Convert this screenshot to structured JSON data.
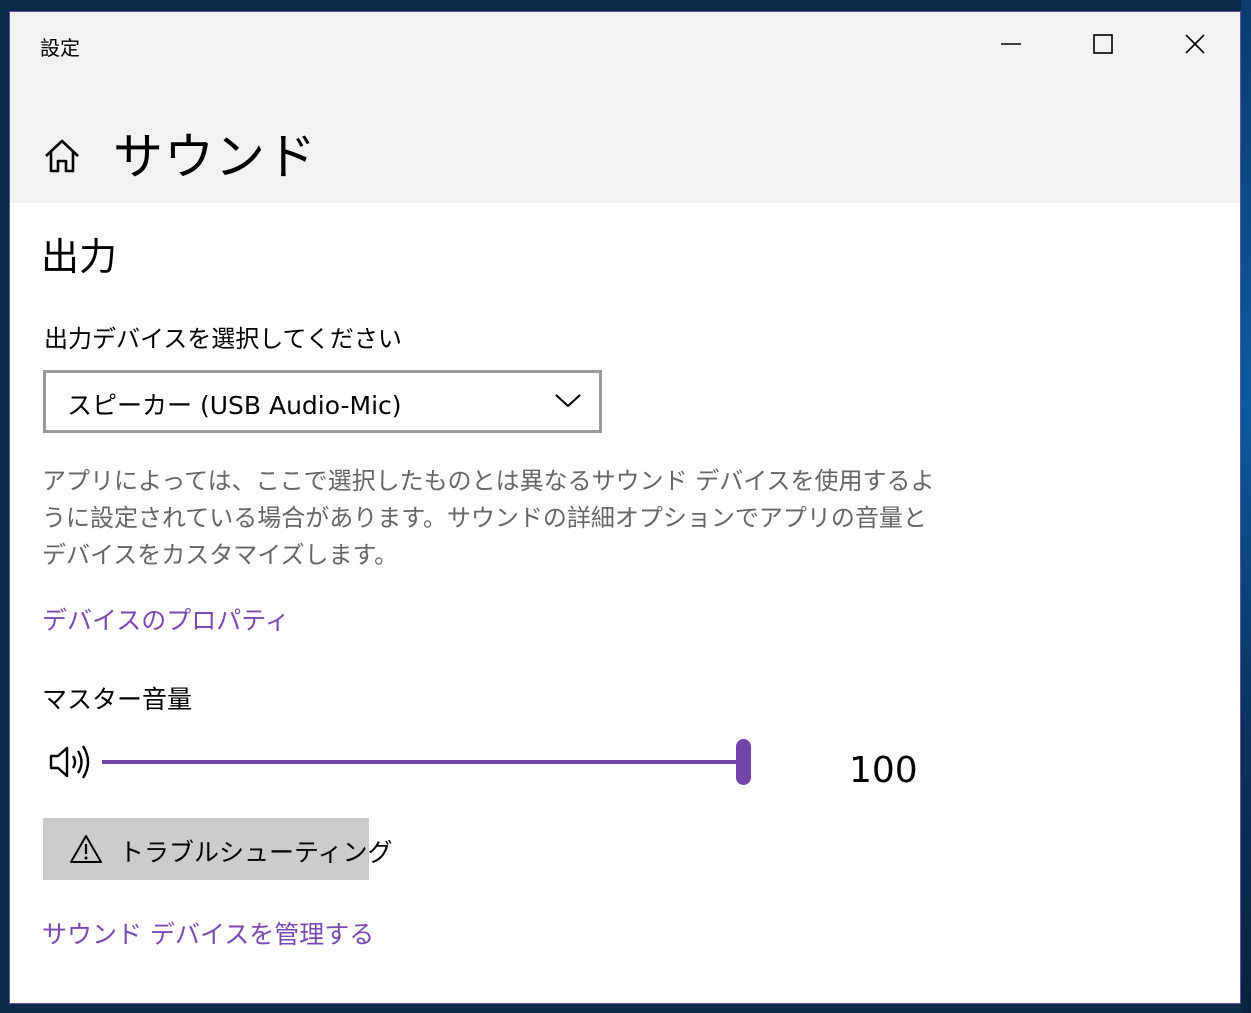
{
  "window": {
    "app_title": "設定"
  },
  "controls": {
    "minimize": "minimize-icon",
    "maximize": "maximize-icon",
    "close": "close-icon"
  },
  "header": {
    "title": "サウンド",
    "home_icon": "home-icon"
  },
  "output": {
    "section_title": "出力",
    "device_label": "出力デバイスを選択してください",
    "device_selected": "スピーカー (USB Audio-Mic)",
    "description": "アプリによっては、ここで選択したものとは異なるサウンド デバイスを使用するように設定されている場合があります。サウンドの詳細オプションでアプリの音量とデバイスをカスタマイズします。",
    "properties_link": "デバイスのプロパティ",
    "master_volume_label": "マスター音量",
    "volume_value": "100",
    "volume_fraction": 1.0,
    "troubleshoot_label": "トラブルシューティング",
    "manage_link": "サウンド デバイスを管理する"
  },
  "colors": {
    "accent": "#7445a8",
    "link": "#7a4ab3",
    "header_bg": "#f2f2f2",
    "button_bg": "#cccccc"
  }
}
